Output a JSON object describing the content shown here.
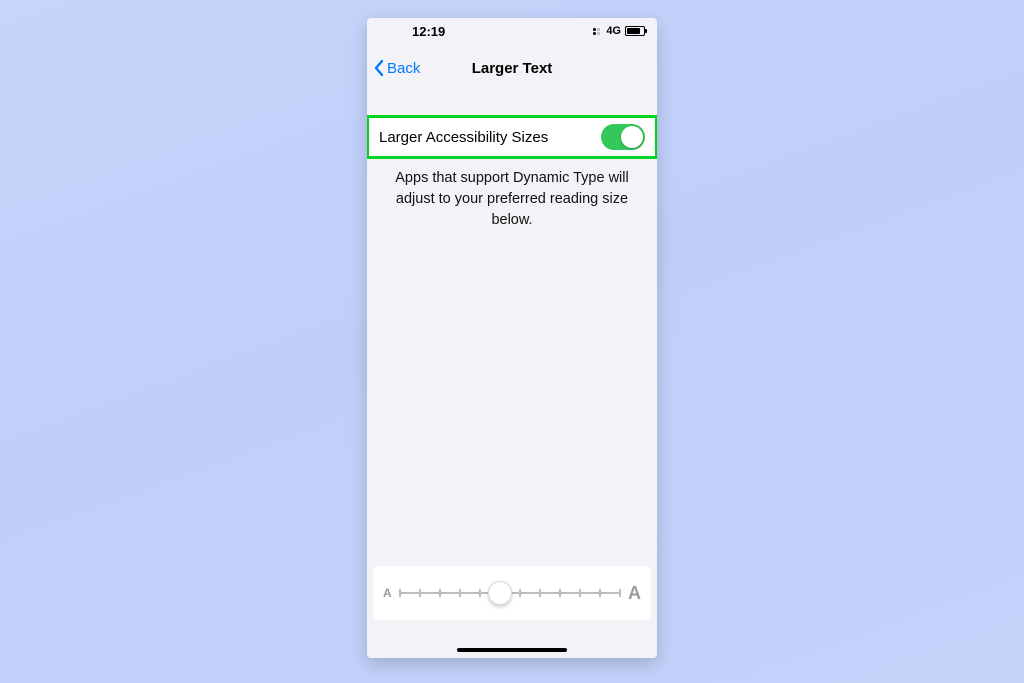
{
  "status": {
    "time": "12:19",
    "network_label": "4G"
  },
  "nav": {
    "back_label": "Back",
    "title": "Larger Text"
  },
  "settings": {
    "larger_sizes_label": "Larger Accessibility Sizes",
    "larger_sizes_on": true,
    "footer_text": "Apps that support Dynamic Type will adjust to your preferred reading size below."
  },
  "slider": {
    "small_label": "A",
    "large_label": "A",
    "ticks": 12,
    "value_index": 5
  },
  "colors": {
    "accent_link": "#007aff",
    "toggle_on": "#34c759",
    "highlight": "#00d321"
  }
}
